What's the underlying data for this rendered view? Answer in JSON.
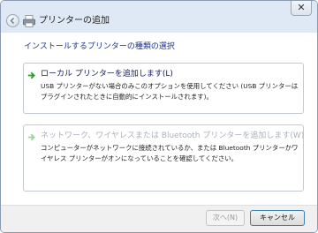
{
  "window": {
    "title": "プリンターの追加",
    "close_label": "✕"
  },
  "main": {
    "heading": "インストールするプリンターの種類の選択",
    "options": [
      {
        "title": "ローカル プリンターを追加します(L)",
        "description": "USB プリンターがない場合のみこのオプションを使用してください (USB プリンターはプラグインされたときに自動的にインストールされます)。",
        "enabled": true
      },
      {
        "title": "ネットワーク、ワイヤレスまたは Bluetooth プリンターを追加します(W)",
        "description": "コンピューターがネットワークに接続されているか、または Bluetooth プリンターかワイヤレス プリンターがオンになっていることを確認してください。",
        "enabled": false
      }
    ]
  },
  "footer": {
    "next_label": "次へ(N)",
    "cancel_label": "キャンセル"
  },
  "colors": {
    "heading": "#1e3287",
    "arrow": "#2e9d2e",
    "disabled_text": "#a9b0bc"
  },
  "icons": {
    "back": "back-arrow-icon",
    "wizard": "printer-icon",
    "option": "green-arrow-icon"
  }
}
